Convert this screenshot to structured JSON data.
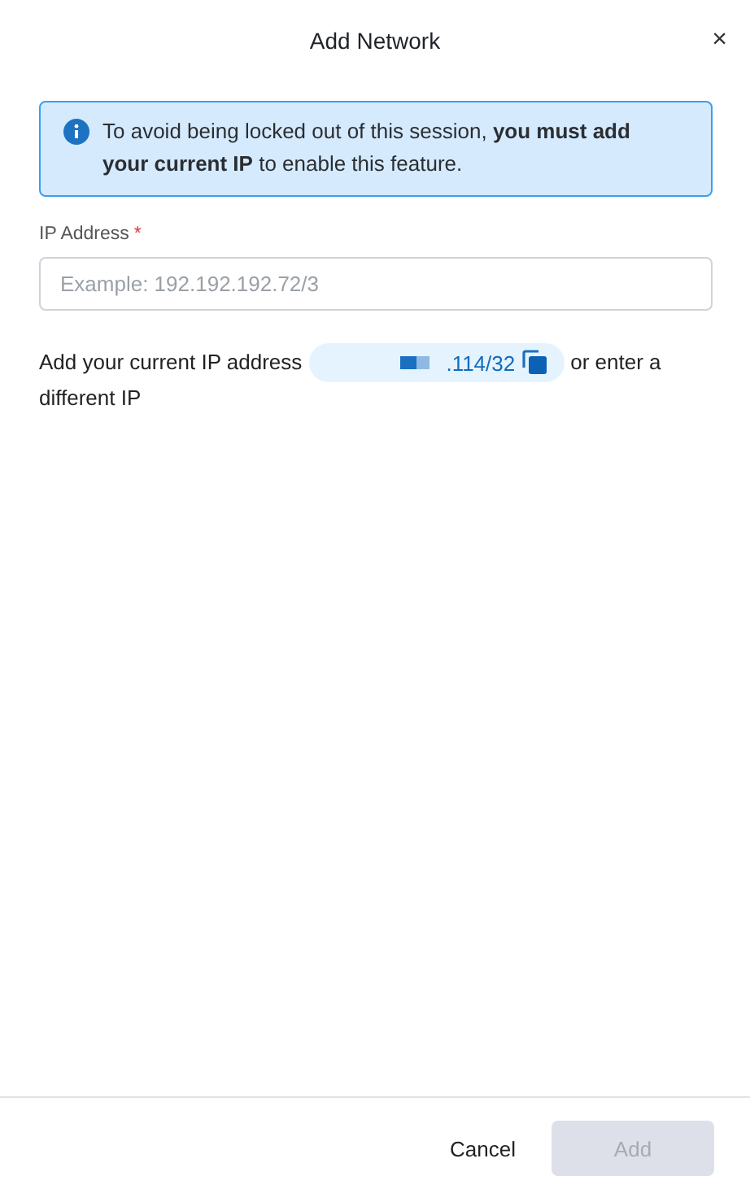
{
  "dialog": {
    "title": "Add Network",
    "close": "×"
  },
  "alert": {
    "text": "To avoid being locked out of this session, **you must add your current IP** to enable this feature."
  },
  "field": {
    "label": "IP Address",
    "required": true,
    "required_mark": "*",
    "placeholder": "Example: 192.192.192.72/3"
  },
  "hint": {
    "before": "Add your current IP address",
    "ip": ".114/32",
    "after": "or enter a",
    "after_continued": "different IP"
  },
  "buttons": [
    {
      "label": "Cancel",
      "kind": "secondary"
    },
    {
      "label": "Add",
      "kind": "primary",
      "disabled": true
    }
  ]
}
